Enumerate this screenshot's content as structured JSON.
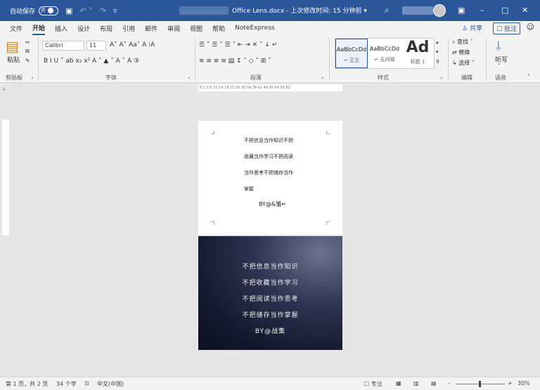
{
  "titlebar": {
    "autosave_label": "自动保存",
    "autosave_state": "开",
    "doc_title": "Office Lens.docx  -  上次修改时间: 15 分钟前  ▾",
    "save_icon": "save-icon",
    "undo_icon": "undo-icon",
    "redo_icon": "redo-icon",
    "search_icon": "search-icon",
    "minimize": "–",
    "maximize": "□",
    "close": "✕",
    "ribbon_display": "▣"
  },
  "tabs": [
    "文件",
    "开始",
    "插入",
    "设计",
    "布局",
    "引用",
    "邮件",
    "审阅",
    "视图",
    "帮助",
    "NoteExpress"
  ],
  "share_label": "♙ 共享",
  "comment_label": "☐ 批注",
  "ribbon": {
    "paste_label": "粘贴",
    "font_name": "Calibri",
    "font_size": "11",
    "font_row1": "A˄  A˅   Aa˅   A   ⁝A",
    "font_row2": "B   I   U ˅  ab  x₂  x²   A ˅   ▲ ˅   A ˅   A   ③",
    "para_row1": "☰ ˅   ☰ ˅   ☰ ˅    ⇤   ⇥    ✕ ˅    ↓    ↵",
    "para_row2": "≡   ≡   ≡   ≡   ▤    ↕ ˅    ◇ ˅   ⊞ ˅",
    "style_normal_sample": "AaBbCcDd",
    "style_normal_name": "↵ 正文",
    "style_nospace_sample": "AaBbCcDd",
    "style_nospace_name": "↵ 无间隔",
    "style_heading_sample": "Ad",
    "style_heading_name": "标题 1",
    "find_label": "⌕ 查找  ˅",
    "replace_label": "⇄ 替换",
    "select_label": "↳ 选择 ˅",
    "dictate_label": "听写",
    "groups": {
      "clipboard": "剪贴板",
      "font": "字体",
      "paragraph": "段落",
      "styles": "样式",
      "editing": "编辑",
      "voice": "语音"
    }
  },
  "ruler_text": "6  2  2   6  10  14  18  22  26  30  34  38  42  46  50  54  58  62",
  "page1": {
    "lines": [
      "不把信息当作知识不把",
      "收藏当作学习不把阅读",
      "当作思考不把储存当作",
      "掌握"
    ],
    "signature": "BY@&雏↵"
  },
  "page2": {
    "lines": [
      "不把信息当作知识",
      "不把收藏当作学习",
      "不把阅读当作思考",
      "不把储存当作掌握",
      "BY@战集"
    ]
  },
  "statusbar": {
    "page_info": "第 1 页，共 2 页",
    "word_count": "34 个字",
    "proof_icon": "proofing-icon",
    "language": "中文(中国)",
    "focus": "☐ 专注",
    "zoom_minus": "–",
    "zoom_plus": "+",
    "zoom_level": "30%"
  }
}
